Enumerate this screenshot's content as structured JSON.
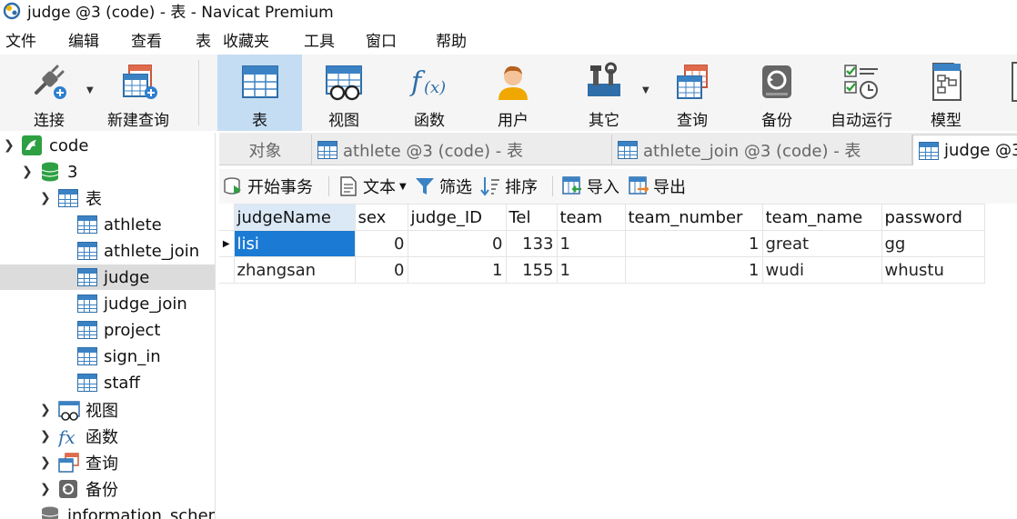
{
  "window": {
    "title": "judge @3 (code) - 表 - Navicat Premium"
  },
  "menu": [
    "文件",
    "编辑",
    "查看",
    "表",
    "收藏夹",
    "工具",
    "窗口",
    "帮助"
  ],
  "toolbar": {
    "connect": "连接",
    "new_query": "新建查询",
    "table": "表",
    "view": "视图",
    "function": "函数",
    "user": "用户",
    "other": "其它",
    "query": "查询",
    "backup": "备份",
    "auto_run": "自动运行",
    "model": "模型"
  },
  "sidebar": {
    "connection": "code",
    "database": "3",
    "tables_group": "表",
    "tables": [
      "athlete",
      "athlete_join",
      "judge",
      "judge_join",
      "project",
      "sign_in",
      "staff"
    ],
    "selected_table": "judge",
    "views_group": "视图",
    "functions_group": "函数",
    "queries_group": "查询",
    "backups_group": "备份",
    "other_db": "information_schem"
  },
  "tabs": {
    "objects": "对象",
    "tab1": "athlete @3 (code) - 表",
    "tab2": "athlete_join @3 (code) - 表",
    "tab3": "judge @3"
  },
  "subtoolbar": {
    "begin_transaction": "开始事务",
    "text": "文本",
    "filter": "筛选",
    "sort": "排序",
    "import": "导入",
    "export": "导出"
  },
  "grid": {
    "columns": [
      "judgeName",
      "sex",
      "judge_ID",
      "Tel",
      "team",
      "team_number",
      "team_name",
      "password"
    ],
    "rows": [
      [
        "lisi",
        "0",
        "0",
        "133",
        "1",
        "1",
        "great",
        "gg"
      ],
      [
        "zhangsan",
        "0",
        "1",
        "155",
        "1",
        "1",
        "wudi",
        "whustu"
      ]
    ]
  },
  "colors": {
    "accent": "#1b7bd4",
    "toolbar_active": "#c4ddf3",
    "table_icon": "#3b82c4"
  }
}
